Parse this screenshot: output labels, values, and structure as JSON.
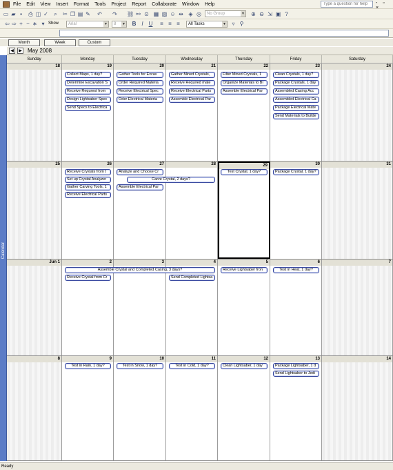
{
  "menu": {
    "items": [
      "File",
      "Edit",
      "View",
      "Insert",
      "Format",
      "Tools",
      "Project",
      "Report",
      "Collaborate",
      "Window",
      "Help"
    ],
    "help_placeholder": "Type a question for help",
    "window_buttons": "- ▫ ×"
  },
  "toolbar": {
    "group_combo": "No Group",
    "font_combo": "Arial",
    "size_combo": "8",
    "filter_combo": "All Tasks",
    "show_label": "Show",
    "bold": "B",
    "italic": "I",
    "underline": "U"
  },
  "view_tabs": {
    "month": "Month",
    "week": "Week",
    "custom": "Custom"
  },
  "month_title": "May 2008",
  "sidebar_label": "Calendar",
  "day_headers": [
    "Sunday",
    "Monday",
    "Tuesday",
    "Wednesday",
    "Thursday",
    "Friday",
    "Saturday"
  ],
  "weeks": [
    {
      "days": [
        "18",
        "19",
        "20",
        "21",
        "22",
        "23",
        "24"
      ]
    },
    {
      "days": [
        "25",
        "26",
        "27",
        "28",
        "29",
        "30",
        "31"
      ]
    },
    {
      "days": [
        "Jun 1",
        "2",
        "3",
        "4",
        "5",
        "6",
        "7"
      ]
    },
    {
      "days": [
        "8",
        "9",
        "10",
        "11",
        "12",
        "13",
        "14"
      ]
    }
  ],
  "events": {
    "w0": [
      [
        "Collect Maps, 1 day?",
        "Determine Excavation S",
        "Receive Requrest from",
        "Design Lightsaber Spec",
        "Send Specs to Electrica"
      ],
      [
        "Gather Tools for Excav",
        "Order Required Materia",
        "Receive Electrical Spec",
        "Oder Electrical Materia"
      ],
      [
        "Gather Mined Crystals,",
        "Receive Required mate",
        "Receive Electrical Parts",
        "Assemble Electrical Par"
      ],
      [
        "Filter Mined Crystals, 1",
        "Organize Materials to Bi",
        "Assemble Electrical Par"
      ],
      [
        "Clean Crystals, 1 day?",
        "Package Crystals, 1 day",
        "Assembled Casing Acc",
        "Assembled Electrical Ca",
        "Package Electrical Mate",
        "Send Materials to Builde"
      ]
    ],
    "w1": {
      "mon": [
        "Receive Crystals from t",
        "Set up Crystal Analyzer",
        "Gather Carving Tools, 1",
        "Receive Electrical Parts"
      ],
      "tue_single": "Analyze and Choose Cr",
      "carve": "Carve Crystal, 2 days?",
      "tue_extra": "Assemble Electrical Par",
      "thu": "Test Crystal, 1 day?",
      "fri": "Package Crystal, 1 day?"
    },
    "w2": {
      "span": "Assemble Crystal and Completed Casing, 3 days?",
      "mon": "Receive Crystal from Cr",
      "wed": "Send Completed Lightsa",
      "thu": "Receive Lightsaber fron",
      "fri": "Test in Heat, 1 day?"
    },
    "w3": {
      "mon": "Test in Rain, 1 day?",
      "tue": "Test in Snow, 1 day?",
      "wed": "Test in Cold, 1 day?",
      "thu": "Clean Lightsaber, 1 day",
      "fri": [
        "Package Lightsaber, 1 d",
        "Send Lightsaber to Jedi"
      ]
    }
  },
  "status": "Ready"
}
